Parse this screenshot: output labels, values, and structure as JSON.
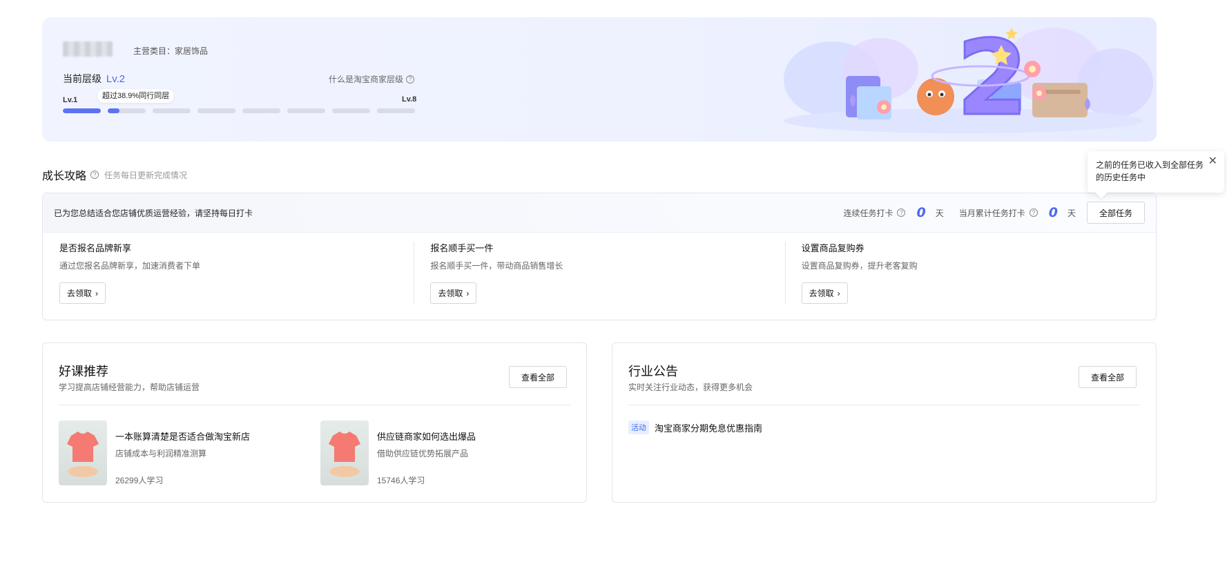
{
  "banner": {
    "category": "主营类目：家居饰品",
    "current_level_label": "当前层级",
    "current_level": "Lv.2",
    "what_is_level": "什么是淘宝商家层级",
    "level_start": "Lv.1",
    "level_end": "Lv.8",
    "peer_bubble": "超过38.9%同行同层",
    "illustration_number": "2",
    "progress_fill": [
      1,
      0.3,
      0,
      0,
      0,
      0,
      0,
      0
    ]
  },
  "growth": {
    "title": "成长攻略",
    "subtitle": "任务每日更新完成情况",
    "intro": "已为您总结适合您店铺优质运营经验，请坚持每日打卡",
    "streak_label": "连续任务打卡",
    "streak_value": "0",
    "streak_unit": "天",
    "monthly_label": "当月累计任务打卡",
    "monthly_value": "0",
    "monthly_unit": "天",
    "all_tasks_button": "全部任务",
    "popover_text": "之前的任务已收入到全部任务的历史任务中",
    "tasks": [
      {
        "name": "是否报名品牌新享",
        "desc": "通过您报名品牌新享，加速消费者下单",
        "button": "去领取"
      },
      {
        "name": "报名顺手买一件",
        "desc": "报名顺手买一件，带动商品销售增长",
        "button": "去领取"
      },
      {
        "name": "设置商品复购券",
        "desc": "设置商品复购券，提升老客复购",
        "button": "去领取"
      }
    ]
  },
  "courses_card": {
    "title": "好课推荐",
    "subtitle": "学习提高店铺经营能力，帮助店铺运营",
    "view_all": "查看全部",
    "items": [
      {
        "name": "一本账算清楚是否适合做淘宝新店",
        "desc": "店铺成本与利润精准测算",
        "students": "26299人学习"
      },
      {
        "name": "供应链商家如何选出爆品",
        "desc": "借助供应链优势拓展产品",
        "students": "15746人学习"
      }
    ]
  },
  "notice_card": {
    "title": "行业公告",
    "subtitle": "实时关注行业动态，获得更多机会",
    "view_all": "查看全部",
    "items": [
      {
        "tag": "活动",
        "text": "淘宝商家分期免息优惠指南"
      }
    ]
  },
  "colors": {
    "accent": "#4d67f2",
    "progress_fill": "#5b73f2",
    "tag_text": "#3b6cf0"
  }
}
